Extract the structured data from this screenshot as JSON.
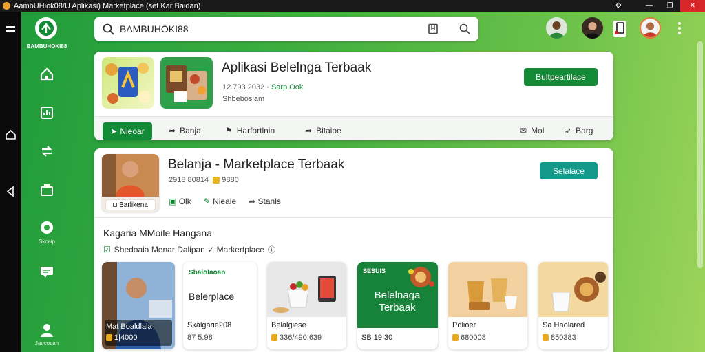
{
  "window": {
    "title": "AambUHiok08/U Aplikasi) Marketplace (set Kar Baidan)"
  },
  "sidebar": {
    "logo_text": "BAMBUHOKI88",
    "chat_label": "Skcaip",
    "account_label": "Jaococan"
  },
  "search": {
    "value": "BAMBUHOKI88"
  },
  "card1": {
    "title": "Aplikasi Belelnga Terbaak",
    "meta_line1": "12.793 2032 ·",
    "meta_highlight": "Sarp Ook",
    "meta_line2": "Shbeboslam",
    "action": "Bultpeartilace",
    "tabs": {
      "active": "Nieoar",
      "t1": "Banja",
      "t2": "Harfortlnin",
      "t3": "Bitaioe",
      "t4": "Mol",
      "t5": "Barg"
    }
  },
  "card2": {
    "title": "Belanja - Marketplace Terbaak",
    "meta": "2918 80814",
    "badge": "9880",
    "avatar_caption": "Barlikena",
    "action": "Selaiace",
    "links": {
      "l1": "Olk",
      "l2": "Nieaie",
      "l3": "Stanls"
    },
    "section_title": "Kagaria MMoile Hangana",
    "section_sub": "Shedoaia Menar Dalipan ✓ Markertplace",
    "products": [
      {
        "name": "Mat Boaldlala",
        "price": "1|4000"
      },
      {
        "name": "Skalgarie208",
        "price": "87 5.98",
        "label_top": "Sbaiolaoan",
        "label_mid": "Belerplace"
      },
      {
        "name": "Belalgiese",
        "price": "336/490.639"
      },
      {
        "name": "SB 19.30",
        "price": "",
        "label_top": "SESUIS",
        "label_mid": "Belelnaga Terbaak"
      },
      {
        "name": "Polioer",
        "price": "680008"
      },
      {
        "name": "Sa Haolared",
        "price": "850383"
      }
    ]
  }
}
